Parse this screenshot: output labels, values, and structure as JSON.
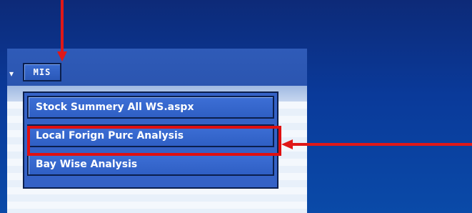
{
  "menubar": {
    "prev_chevron": "▾",
    "mis_label": "MIS"
  },
  "dropdown": {
    "items": [
      {
        "label": "Stock Summery All WS.aspx"
      },
      {
        "label": "Local Forign Purc Analysis",
        "highlighted": true
      },
      {
        "label": "Bay Wise Analysis"
      }
    ]
  },
  "annotations": {
    "arrow_color": "#e01818",
    "highlight_color": "#e01010",
    "arrow_down_target": "mis-menu-button",
    "arrow_left_target": "menu-item-local-forign-purc-analysis"
  },
  "colors": {
    "background": "#0a3a9a",
    "menubar": "#2f5bb8",
    "menu_item": "#3562c6",
    "menu_border": "#0b1f4d"
  }
}
